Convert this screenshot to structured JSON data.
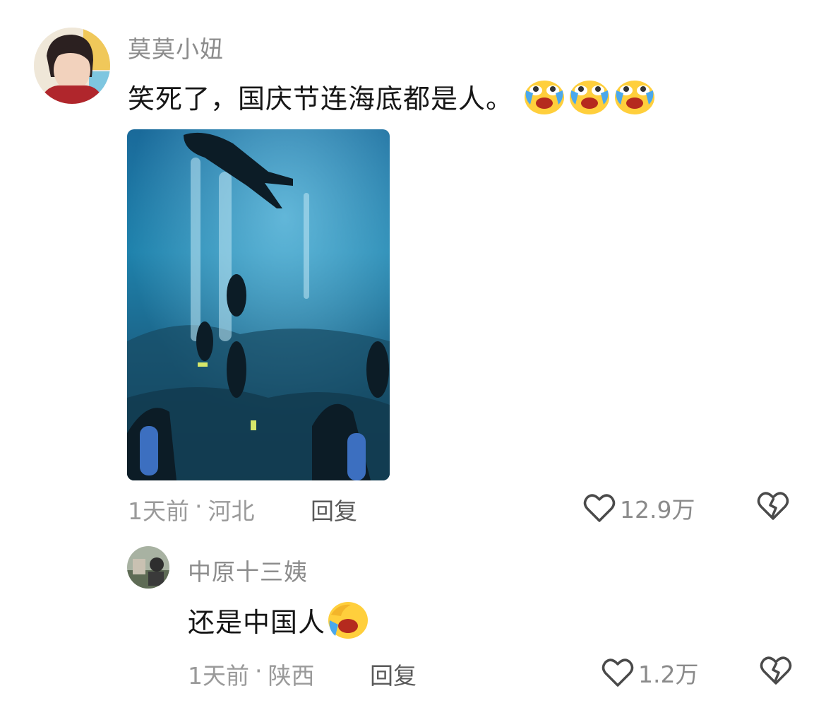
{
  "comments": [
    {
      "username": "莫莫小妞",
      "text": "笑死了，国庆节连海底都是人。",
      "emoji": "crying-laughing-emoji",
      "time": "1天前",
      "separator": "·",
      "location": "河北",
      "reply_label": "回复",
      "like_count": "12.9万",
      "has_image": true
    },
    {
      "username": "中原十三姨",
      "text": "还是中国人",
      "emoji": "facepalm-laugh-emoji",
      "time": "1天前",
      "separator": "·",
      "location": "陕西",
      "reply_label": "回复",
      "like_count": "1.2万"
    }
  ],
  "icons": [
    "heart-icon",
    "broken-heart-icon"
  ],
  "colors": {
    "meta_gray": "#9a9a9a",
    "name_gray": "#8c8c8c",
    "ocean_blue": "#1f7ea3"
  }
}
